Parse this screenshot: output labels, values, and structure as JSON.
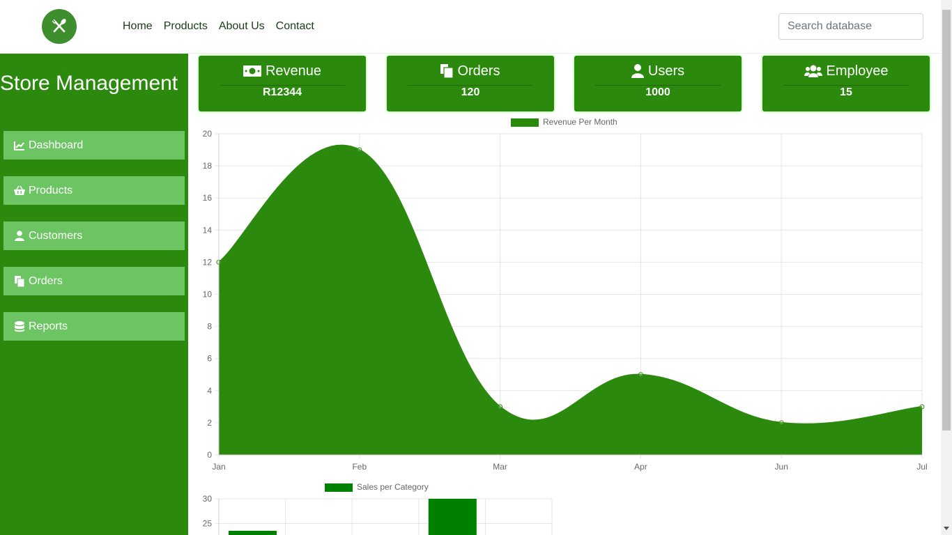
{
  "navbar": {
    "links": [
      "Home",
      "Products",
      "About Us",
      "Contact"
    ],
    "search_placeholder": "Search database",
    "logo_icon": "fork-knife-icon"
  },
  "sidebar": {
    "title": "Store Management",
    "items": [
      {
        "label": "Dashboard",
        "icon": "chart-line-icon"
      },
      {
        "label": "Products",
        "icon": "basket-icon"
      },
      {
        "label": "Customers",
        "icon": "user-icon"
      },
      {
        "label": "Orders",
        "icon": "copy-icon"
      },
      {
        "label": "Reports",
        "icon": "database-icon"
      }
    ]
  },
  "cards": [
    {
      "title": "Revenue",
      "value": "R12344",
      "icon": "money-bill-icon"
    },
    {
      "title": "Orders",
      "value": "120",
      "icon": "copy-icon"
    },
    {
      "title": "Users",
      "value": "1000",
      "icon": "user-icon"
    },
    {
      "title": "Employee",
      "value": "15",
      "icon": "users-icon"
    }
  ],
  "colors": {
    "primary": "#2b8a0d",
    "sidebar_item": "#6cc463",
    "bar": "#008000"
  },
  "chart_data": [
    {
      "type": "area",
      "title": "",
      "legend": "Revenue Per Month",
      "legend_position": "top-center",
      "categories": [
        "Jan",
        "Feb",
        "Mar",
        "Apr",
        "Jun",
        "Jul"
      ],
      "series": [
        {
          "name": "Revenue Per Month",
          "values": [
            12,
            19,
            3,
            5,
            2,
            3
          ]
        }
      ],
      "ylim": [
        0,
        20
      ],
      "yticks": [
        0,
        2,
        4,
        6,
        8,
        10,
        12,
        14,
        16,
        18,
        20
      ],
      "grid": true
    },
    {
      "type": "bar",
      "title": "",
      "legend": "Sales per Category",
      "legend_position": "top-center",
      "visible_yticks": [
        30,
        25
      ],
      "ylim": [
        0,
        30
      ],
      "partial_values_visible": [
        23.5,
        30
      ],
      "grid": true
    }
  ]
}
